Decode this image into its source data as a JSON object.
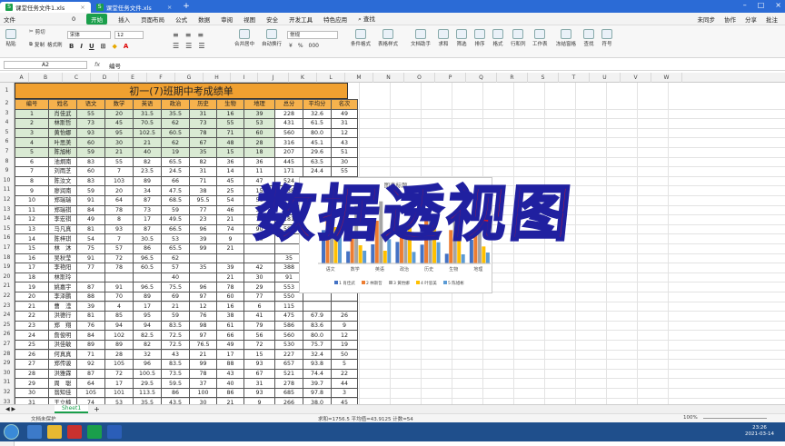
{
  "titlebar": {
    "tabs": [
      {
        "label": "课堂任务文件1.xls",
        "active": true
      },
      {
        "label": "课堂任务文件.xls",
        "active": false
      }
    ]
  },
  "menubar": {
    "file": "文件",
    "undo_count": "0",
    "start": "开始",
    "items": [
      "插入",
      "页面布局",
      "公式",
      "数据",
      "审阅",
      "视图",
      "安全",
      "开发工具",
      "特色应用"
    ],
    "search": "查找",
    "right": [
      "未同步",
      "协作",
      "分享",
      "批注"
    ]
  },
  "ribbon": {
    "paste": "粘贴",
    "cut": "剪切",
    "copy": "复制",
    "format_painter": "格式刷",
    "font_name": "宋体",
    "font_size": "12",
    "merge_center": "合并居中",
    "wrap": "自动换行",
    "number_format": "常规",
    "conditional": "条件格式",
    "table_style": "表格样式",
    "doc_helper": "文档助手",
    "sum": "求和",
    "filter": "筛选",
    "sort": "排序",
    "format": "格式",
    "rowcol": "行和列",
    "worksheet": "工作表",
    "freeze": "冻结窗格",
    "find": "查找",
    "symbol": "符号"
  },
  "formula": {
    "cell_ref": "A2",
    "fx": "fx",
    "value": "编号"
  },
  "columns": [
    "A",
    "B",
    "C",
    "D",
    "E",
    "F",
    "G",
    "H",
    "I",
    "J",
    "K",
    "L",
    "M",
    "N",
    "O",
    "P",
    "Q",
    "R",
    "S",
    "T",
    "U",
    "V",
    "W"
  ],
  "sheet": {
    "title": "初一(7)班期中考成绩单",
    "headers": [
      "编号",
      "姓名",
      "语文",
      "数学",
      "英语",
      "政治",
      "历史",
      "生物",
      "地理",
      "总分",
      "平均分",
      "名次"
    ],
    "rows": [
      [
        "1",
        "肖佳武",
        "55",
        "20",
        "31.5",
        "35.5",
        "31",
        "16",
        "39",
        "228",
        "32.6",
        "49"
      ],
      [
        "2",
        "林斯哲",
        "73",
        "45",
        "70.5",
        "62",
        "73",
        "55",
        "53",
        "431",
        "61.5",
        "31"
      ],
      [
        "3",
        "黄怡娜",
        "93",
        "95",
        "102.5",
        "60.5",
        "78",
        "71",
        "60",
        "560",
        "80.0",
        "12"
      ],
      [
        "4",
        "叶思美",
        "60",
        "30",
        "21",
        "62",
        "67",
        "48",
        "28",
        "316",
        "45.1",
        "43"
      ],
      [
        "5",
        "陈旭彬",
        "59",
        "21",
        "40",
        "19",
        "35",
        "15",
        "18",
        "207",
        "29.6",
        "51"
      ],
      [
        "6",
        "池炯南",
        "83",
        "55",
        "82",
        "65.5",
        "82",
        "36",
        "36",
        "445",
        "63.5",
        "30"
      ],
      [
        "7",
        "刘雨芝",
        "60",
        "7",
        "23.5",
        "24.5",
        "31",
        "14",
        "11",
        "171",
        "24.4",
        "55"
      ],
      [
        "8",
        "陈汝文",
        "83",
        "103",
        "89",
        "66",
        "71",
        "45",
        "47",
        "524",
        "74.9",
        "22"
      ],
      [
        "9",
        "廖润南",
        "59",
        "20",
        "34",
        "47.5",
        "38",
        "25",
        "15",
        "238",
        "34.0",
        "48"
      ],
      [
        "10",
        "郑瑞瑞",
        "91",
        "64",
        "87",
        "68.5",
        "95.5",
        "54",
        "56",
        "516",
        "73.6",
        "23"
      ],
      [
        "11",
        "郑瑞祺",
        "84",
        "78",
        "73",
        "59",
        "77",
        "46",
        "32",
        "449",
        "64.2",
        "28"
      ],
      [
        "12",
        "李宏祺",
        "49",
        "8",
        "17",
        "49.5",
        "23",
        "21",
        "14",
        "181",
        "25.9",
        "54"
      ],
      [
        "13",
        "马凡真",
        "81",
        "93",
        "87",
        "66.5",
        "96",
        "74",
        "90",
        "587",
        "",
        ""
      ],
      [
        "14",
        "陈梓琪",
        "54",
        "7",
        "30.5",
        "53",
        "39",
        "9",
        "10",
        "",
        "",
        ""
      ],
      [
        "15",
        "林　沐",
        "75",
        "57",
        "86",
        "65.5",
        "99",
        "21",
        "",
        "",
        "",
        ""
      ],
      [
        "16",
        "吴秋莹",
        "91",
        "72",
        "96.5",
        "62",
        "",
        "",
        "",
        "35",
        "",
        ""
      ],
      [
        "17",
        "李艳阳",
        "77",
        "78",
        "60.5",
        "57",
        "35",
        "39",
        "42",
        "388",
        "",
        ""
      ],
      [
        "18",
        "林斯玲",
        "",
        "",
        "",
        "40",
        "",
        "21",
        "30",
        "91",
        "",
        ""
      ],
      [
        "19",
        "姚嘉宇",
        "87",
        "91",
        "96.5",
        "75.5",
        "96",
        "78",
        "29",
        "553",
        "",
        ""
      ],
      [
        "20",
        "李泽鹏",
        "88",
        "70",
        "89",
        "69",
        "97",
        "60",
        "77",
        "550",
        "",
        ""
      ],
      [
        "21",
        "曹　滢",
        "39",
        "4",
        "17",
        "21",
        "12",
        "16",
        "6",
        "115",
        "",
        ""
      ],
      [
        "22",
        "洪德行",
        "81",
        "85",
        "95",
        "59",
        "76",
        "38",
        "41",
        "475",
        "67.9",
        "26"
      ],
      [
        "23",
        "郑　翔",
        "76",
        "94",
        "94",
        "83.5",
        "98",
        "61",
        "79",
        "586",
        "83.6",
        "9"
      ],
      [
        "24",
        "詹俊明",
        "84",
        "102",
        "82.5",
        "72.5",
        "97",
        "66",
        "56",
        "560",
        "80.0",
        "12"
      ],
      [
        "25",
        "洪佳敏",
        "89",
        "89",
        "82",
        "72.5",
        "76.5",
        "49",
        "72",
        "530",
        "75.7",
        "19"
      ],
      [
        "26",
        "何真真",
        "71",
        "28",
        "32",
        "43",
        "21",
        "17",
        "15",
        "227",
        "32.4",
        "50"
      ],
      [
        "27",
        "郑传骏",
        "92",
        "105",
        "96",
        "83.5",
        "99",
        "88",
        "93",
        "657",
        "93.8",
        "5"
      ],
      [
        "28",
        "洪雅霖",
        "87",
        "72",
        "100.5",
        "73.5",
        "78",
        "43",
        "67",
        "521",
        "74.4",
        "22"
      ],
      [
        "29",
        "周　聪",
        "64",
        "17",
        "29.5",
        "59.5",
        "37",
        "40",
        "31",
        "278",
        "39.7",
        "44"
      ],
      [
        "30",
        "翁知佳",
        "105",
        "101",
        "113.5",
        "86",
        "100",
        "86",
        "93",
        "685",
        "97.8",
        "3"
      ],
      [
        "31",
        "王立楠",
        "74",
        "53",
        "35.5",
        "43.5",
        "30",
        "21",
        "9",
        "266",
        "38.0",
        "45"
      ],
      [
        "32",
        "陈言鹏",
        "84",
        "118",
        "84",
        "86",
        "100",
        "68",
        "94",
        "634",
        "90.6",
        "6"
      ],
      [
        "33",
        "刘诺宇",
        "95",
        "95",
        "101",
        "73.5",
        "82",
        "40",
        "43",
        "530",
        "75.6",
        "20"
      ],
      [
        "34",
        "陈　平",
        "88",
        "87",
        "86",
        "61.5",
        "91",
        "54",
        "42",
        "510",
        "72.8",
        "24"
      ],
      [
        "35",
        "林婉湘",
        "87",
        "66",
        "84.5",
        "61",
        "82",
        "66",
        "43",
        "490",
        "69.9",
        "25"
      ]
    ]
  },
  "chart": {
    "placeholder_title": "图表标题"
  },
  "chart_data": {
    "type": "bar",
    "title": "图表标题",
    "categories": [
      "语文",
      "数学",
      "英语",
      "政治",
      "历史",
      "生物",
      "地理"
    ],
    "series": [
      {
        "name": "1 肖佳武",
        "values": [
          55,
          20,
          31.5,
          35.5,
          31,
          16,
          39
        ]
      },
      {
        "name": "2 林斯哲",
        "values": [
          73,
          45,
          70.5,
          62,
          73,
          55,
          53
        ]
      },
      {
        "name": "3 黄怡娜",
        "values": [
          93,
          95,
          102.5,
          60.5,
          78,
          71,
          60
        ]
      },
      {
        "name": "4 叶思美",
        "values": [
          60,
          30,
          21,
          62,
          67,
          48,
          28
        ]
      },
      {
        "name": "5 陈旭彬",
        "values": [
          59,
          21,
          40,
          19,
          35,
          15,
          18
        ]
      }
    ],
    "colors": [
      "#4472c4",
      "#ed7d31",
      "#a5a5a5",
      "#ffc000",
      "#5b9bd5"
    ],
    "ylim": [
      0,
      120
    ]
  },
  "overlay": {
    "text": "数据透视图"
  },
  "sheettabs": {
    "sheet": "Sheet1",
    "add": "+"
  },
  "statusbar": {
    "protect": "文档未保护",
    "stats": "求和=1756.5  平均值=43.9125  计数=54",
    "zoom": "100%"
  },
  "taskbar": {
    "time": "23:26",
    "date": "2021-03-14"
  }
}
